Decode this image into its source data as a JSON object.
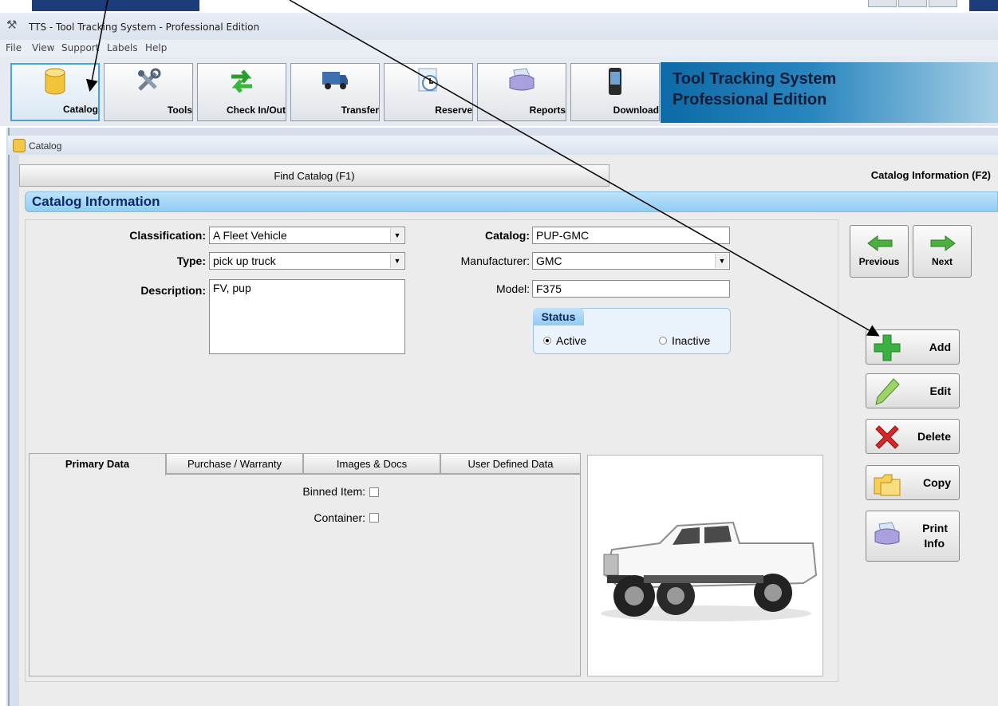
{
  "window": {
    "title": "TTS - Tool Tracking System - Professional Edition"
  },
  "menu": [
    "File",
    "View",
    "Support",
    "Labels",
    "Help"
  ],
  "toolbar": {
    "buttons": [
      {
        "label": "Catalog",
        "icon": "database-icon"
      },
      {
        "label": "Tools",
        "icon": "tools-icon"
      },
      {
        "label": "Check In/Out",
        "icon": "exchange-arrows-icon"
      },
      {
        "label": "Transfer",
        "icon": "truck-icon"
      },
      {
        "label": "Reserve",
        "icon": "clock-icon"
      },
      {
        "label": "Reports",
        "icon": "printer-icon"
      },
      {
        "label": "Download",
        "icon": "mobile-device-icon"
      }
    ],
    "banner_line1": "Tool Tracking System",
    "banner_line2": "Professional Edition"
  },
  "catalog_window": {
    "title": "Catalog",
    "tabs": {
      "find": "Find Catalog (F1)",
      "info": "Catalog Information (F2)"
    },
    "section_title": "Catalog Information"
  },
  "form": {
    "classification_label": "Classification:",
    "classification_value": "A Fleet Vehicle",
    "type_label": "Type:",
    "type_value": "pick up truck",
    "description_label": "Description:",
    "description_value": "FV, pup",
    "catalog_label": "Catalog:",
    "catalog_value": "PUP-GMC",
    "manufacturer_label": "Manufacturer:",
    "manufacturer_value": "GMC",
    "model_label": "Model:",
    "model_value": "F375",
    "status_title": "Status",
    "status_active": "Active",
    "status_inactive": "Inactive",
    "status_selected": "Active"
  },
  "nav": {
    "previous": "Previous",
    "next": "Next"
  },
  "actions": {
    "add": "Add",
    "edit": "Edit",
    "delete": "Delete",
    "copy": "Copy",
    "print_line1": "Print",
    "print_line2": "Info"
  },
  "subtabs": [
    "Primary Data",
    "Purchase / Warranty",
    "Images & Docs",
    "User Defined Data"
  ],
  "primary_data": {
    "binned_item_label": "Binned Item:",
    "container_label": "Container:"
  },
  "colors": {
    "banner": "#0d6aa6",
    "section": "#8fcdf4",
    "add_green": "#3cb043",
    "delete_red": "#d62828"
  }
}
